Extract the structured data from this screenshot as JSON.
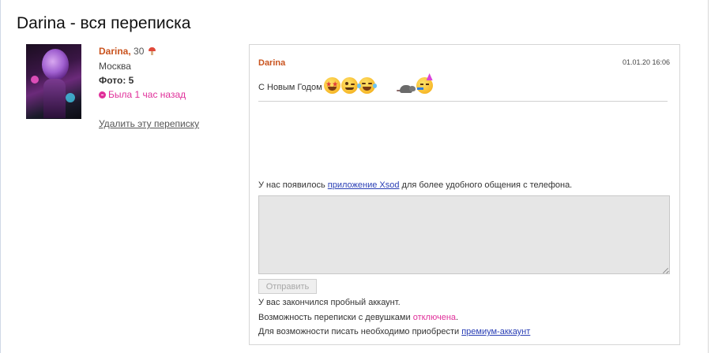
{
  "page": {
    "title": "Darina - вся переписка"
  },
  "profile": {
    "name": "Darina,",
    "age": "30",
    "city": "Москва",
    "photos": "Фото: 5",
    "status": "Была 1 час назад",
    "delete_link": "Удалить эту переписку"
  },
  "message": {
    "author": "Darina",
    "date": "01.01.20 16:06",
    "text": "С Новым Годом",
    "emojis": [
      "star-struck",
      "winking-face",
      "tears-of-joy",
      "rat",
      "partying-face"
    ]
  },
  "composer": {
    "app_note_before": "У нас появилось ",
    "app_link": "приложение Xsod",
    "app_note_after": " для более удобного общения с телефона.",
    "textarea_value": "",
    "send_label": "Отправить"
  },
  "notices": {
    "trial_ended": "У вас закончился пробный аккаунт.",
    "messaging_before": "Возможность переписки с девушками ",
    "messaging_status": "отключена",
    "messaging_after": ".",
    "premium_before": "Для возможности писать необходимо приобрести ",
    "premium_link": "премиум-аккаунт"
  },
  "colors": {
    "accent_name": "#c9531e",
    "online_status": "#e0309a",
    "link": "#2a3fb5"
  }
}
